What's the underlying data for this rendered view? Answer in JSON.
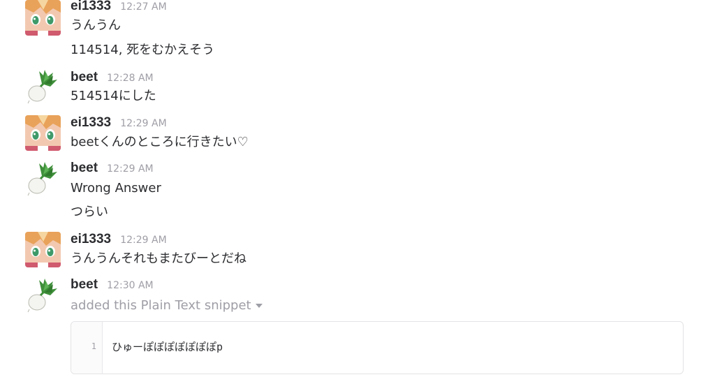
{
  "messages": [
    {
      "author": "ei1333",
      "time": "12:27 AM",
      "avatar_icon": "anime-girl-avatar-icon",
      "lines": [
        "うんうん",
        "114514, 死をむかえそう"
      ]
    },
    {
      "author": "beet",
      "time": "12:28 AM",
      "avatar_icon": "turnip-avatar-icon",
      "lines": [
        "514514にした"
      ]
    },
    {
      "author": "ei1333",
      "time": "12:29 AM",
      "avatar_icon": "anime-girl-avatar-icon",
      "lines": [
        "beetくんのところに行きたい♡"
      ]
    },
    {
      "author": "beet",
      "time": "12:29 AM",
      "avatar_icon": "turnip-avatar-icon",
      "lines": [
        "Wrong Answer",
        "つらい"
      ]
    },
    {
      "author": "ei1333",
      "time": "12:29 AM",
      "avatar_icon": "anime-girl-avatar-icon",
      "lines": [
        "うんうんそれもまたびーとだね"
      ]
    },
    {
      "author": "beet",
      "time": "12:30 AM",
      "avatar_icon": "turnip-avatar-icon",
      "action": "added this Plain Text snippet",
      "snippet": {
        "line_number": "1",
        "content": "ひゅーぽぽぽぽぽぽぽp"
      }
    }
  ],
  "colors": {
    "text": "#2c2d30",
    "muted": "#9e9ea6",
    "snippet_border": "#e3e3e6"
  }
}
